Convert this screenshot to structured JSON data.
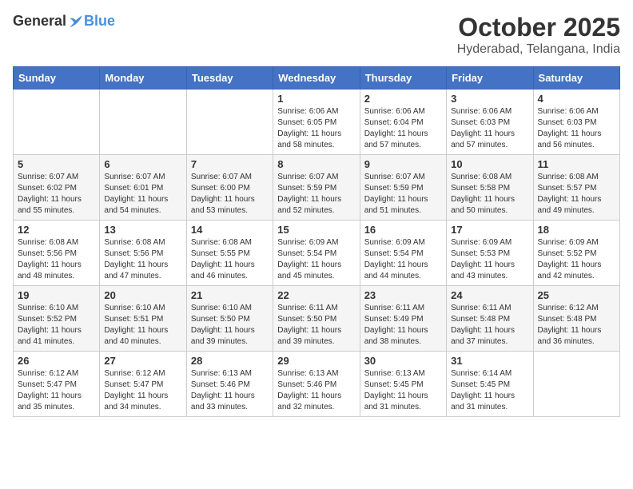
{
  "header": {
    "logo_general": "General",
    "logo_blue": "Blue",
    "title": "October 2025",
    "location": "Hyderabad, Telangana, India"
  },
  "weekdays": [
    "Sunday",
    "Monday",
    "Tuesday",
    "Wednesday",
    "Thursday",
    "Friday",
    "Saturday"
  ],
  "weeks": [
    [
      {
        "day": "",
        "info": ""
      },
      {
        "day": "",
        "info": ""
      },
      {
        "day": "",
        "info": ""
      },
      {
        "day": "1",
        "info": "Sunrise: 6:06 AM\nSunset: 6:05 PM\nDaylight: 11 hours and 58 minutes."
      },
      {
        "day": "2",
        "info": "Sunrise: 6:06 AM\nSunset: 6:04 PM\nDaylight: 11 hours and 57 minutes."
      },
      {
        "day": "3",
        "info": "Sunrise: 6:06 AM\nSunset: 6:03 PM\nDaylight: 11 hours and 57 minutes."
      },
      {
        "day": "4",
        "info": "Sunrise: 6:06 AM\nSunset: 6:03 PM\nDaylight: 11 hours and 56 minutes."
      }
    ],
    [
      {
        "day": "5",
        "info": "Sunrise: 6:07 AM\nSunset: 6:02 PM\nDaylight: 11 hours and 55 minutes."
      },
      {
        "day": "6",
        "info": "Sunrise: 6:07 AM\nSunset: 6:01 PM\nDaylight: 11 hours and 54 minutes."
      },
      {
        "day": "7",
        "info": "Sunrise: 6:07 AM\nSunset: 6:00 PM\nDaylight: 11 hours and 53 minutes."
      },
      {
        "day": "8",
        "info": "Sunrise: 6:07 AM\nSunset: 5:59 PM\nDaylight: 11 hours and 52 minutes."
      },
      {
        "day": "9",
        "info": "Sunrise: 6:07 AM\nSunset: 5:59 PM\nDaylight: 11 hours and 51 minutes."
      },
      {
        "day": "10",
        "info": "Sunrise: 6:08 AM\nSunset: 5:58 PM\nDaylight: 11 hours and 50 minutes."
      },
      {
        "day": "11",
        "info": "Sunrise: 6:08 AM\nSunset: 5:57 PM\nDaylight: 11 hours and 49 minutes."
      }
    ],
    [
      {
        "day": "12",
        "info": "Sunrise: 6:08 AM\nSunset: 5:56 PM\nDaylight: 11 hours and 48 minutes."
      },
      {
        "day": "13",
        "info": "Sunrise: 6:08 AM\nSunset: 5:56 PM\nDaylight: 11 hours and 47 minutes."
      },
      {
        "day": "14",
        "info": "Sunrise: 6:08 AM\nSunset: 5:55 PM\nDaylight: 11 hours and 46 minutes."
      },
      {
        "day": "15",
        "info": "Sunrise: 6:09 AM\nSunset: 5:54 PM\nDaylight: 11 hours and 45 minutes."
      },
      {
        "day": "16",
        "info": "Sunrise: 6:09 AM\nSunset: 5:54 PM\nDaylight: 11 hours and 44 minutes."
      },
      {
        "day": "17",
        "info": "Sunrise: 6:09 AM\nSunset: 5:53 PM\nDaylight: 11 hours and 43 minutes."
      },
      {
        "day": "18",
        "info": "Sunrise: 6:09 AM\nSunset: 5:52 PM\nDaylight: 11 hours and 42 minutes."
      }
    ],
    [
      {
        "day": "19",
        "info": "Sunrise: 6:10 AM\nSunset: 5:52 PM\nDaylight: 11 hours and 41 minutes."
      },
      {
        "day": "20",
        "info": "Sunrise: 6:10 AM\nSunset: 5:51 PM\nDaylight: 11 hours and 40 minutes."
      },
      {
        "day": "21",
        "info": "Sunrise: 6:10 AM\nSunset: 5:50 PM\nDaylight: 11 hours and 39 minutes."
      },
      {
        "day": "22",
        "info": "Sunrise: 6:11 AM\nSunset: 5:50 PM\nDaylight: 11 hours and 39 minutes."
      },
      {
        "day": "23",
        "info": "Sunrise: 6:11 AM\nSunset: 5:49 PM\nDaylight: 11 hours and 38 minutes."
      },
      {
        "day": "24",
        "info": "Sunrise: 6:11 AM\nSunset: 5:48 PM\nDaylight: 11 hours and 37 minutes."
      },
      {
        "day": "25",
        "info": "Sunrise: 6:12 AM\nSunset: 5:48 PM\nDaylight: 11 hours and 36 minutes."
      }
    ],
    [
      {
        "day": "26",
        "info": "Sunrise: 6:12 AM\nSunset: 5:47 PM\nDaylight: 11 hours and 35 minutes."
      },
      {
        "day": "27",
        "info": "Sunrise: 6:12 AM\nSunset: 5:47 PM\nDaylight: 11 hours and 34 minutes."
      },
      {
        "day": "28",
        "info": "Sunrise: 6:13 AM\nSunset: 5:46 PM\nDaylight: 11 hours and 33 minutes."
      },
      {
        "day": "29",
        "info": "Sunrise: 6:13 AM\nSunset: 5:46 PM\nDaylight: 11 hours and 32 minutes."
      },
      {
        "day": "30",
        "info": "Sunrise: 6:13 AM\nSunset: 5:45 PM\nDaylight: 11 hours and 31 minutes."
      },
      {
        "day": "31",
        "info": "Sunrise: 6:14 AM\nSunset: 5:45 PM\nDaylight: 11 hours and 31 minutes."
      },
      {
        "day": "",
        "info": ""
      }
    ]
  ]
}
